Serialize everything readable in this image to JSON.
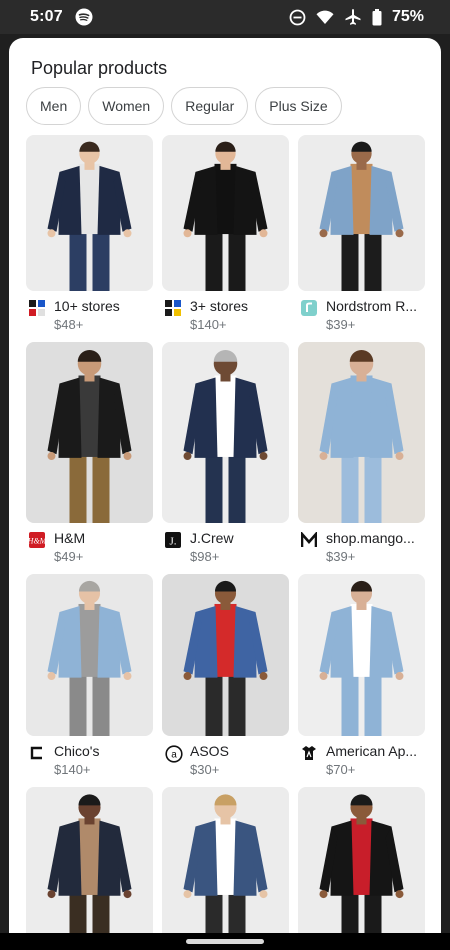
{
  "status_bar": {
    "time": "5:07",
    "battery": "75%",
    "icons": [
      "spotify-icon",
      "do-not-disturb-icon",
      "wifi-icon",
      "airplane-icon",
      "battery-icon"
    ]
  },
  "section": {
    "title": "Popular products",
    "chips": [
      {
        "label": "Men"
      },
      {
        "label": "Women"
      },
      {
        "label": "Regular"
      },
      {
        "label": "Plus Size"
      }
    ]
  },
  "products": [
    {
      "store": "10+ stores",
      "price": "$48+",
      "logo": "multi-store-icon",
      "jacket_color": "#1f2a44",
      "shirt_color": "#e6e6e6",
      "pants_color": "#2c3e63",
      "bg": "#ececec",
      "skin": "#e8c4a6",
      "hair": "#3a2a1f"
    },
    {
      "store": "3+ stores",
      "price": "$140+",
      "logo": "multi-store-icon",
      "jacket_color": "#141414",
      "shirt_color": "#111111",
      "pants_color": "#1a1a1a",
      "bg": "#ececec",
      "skin": "#e2b797",
      "hair": "#2a1f18"
    },
    {
      "store": "Nordstrom R...",
      "price": "$39+",
      "logo": "nordstrom-rack-icon",
      "jacket_color": "#7fa3c8",
      "shirt_color": "#c08c5c",
      "pants_color": "#1c1c1c",
      "bg": "#ececec",
      "skin": "#9a6a4a",
      "hair": "#1a1a1a"
    },
    {
      "store": "H&M",
      "price": "$49+",
      "logo": "hm-icon",
      "jacket_color": "#1a1a1a",
      "shirt_color": "#3a3a3a",
      "pants_color": "#8a6a3a",
      "bg": "#dedede",
      "skin": "#c89a78",
      "hair": "#2a1f18"
    },
    {
      "store": "J.Crew",
      "price": "$98+",
      "logo": "jcrew-icon",
      "jacket_color": "#22304f",
      "shirt_color": "#ffffff",
      "pants_color": "#243350",
      "bg": "#ececec",
      "skin": "#6e4a34",
      "hair": "#b5b5b5"
    },
    {
      "store": "shop.mango...",
      "price": "$39+",
      "logo": "mango-icon",
      "jacket_color": "#8fb3d6",
      "shirt_color": "#8fb3d6",
      "pants_color": "#9cbcdc",
      "bg": "#e4e0da",
      "skin": "#d8b096",
      "hair": "#5a3a24"
    },
    {
      "store": "Chico's",
      "price": "$140+",
      "logo": "chicos-icon",
      "jacket_color": "#8fb3d6",
      "shirt_color": "#9c9c9c",
      "pants_color": "#8a8a8a",
      "bg": "#e8e8e8",
      "skin": "#e6c2a6",
      "hair": "#a8a6a2"
    },
    {
      "store": "ASOS",
      "price": "$30+",
      "logo": "asos-icon",
      "jacket_color": "#3f64a3",
      "shirt_color": "#d42a2a",
      "pants_color": "#2a2a2a",
      "bg": "#dcdcdc",
      "skin": "#8a5a3a",
      "hair": "#1a1a1a"
    },
    {
      "store": "American Ap...",
      "price": "$70+",
      "logo": "american-eagle-icon",
      "jacket_color": "#8fb3d6",
      "shirt_color": "#ffffff",
      "pants_color": "#8fb3d6",
      "bg": "#eeeeee",
      "skin": "#d8b096",
      "hair": "#2a1f18"
    },
    {
      "store": "",
      "price": "",
      "logo": "",
      "jacket_color": "#222a3c",
      "shirt_color": "#b08a6a",
      "pants_color": "#3a2e22",
      "bg": "#ececec",
      "skin": "#6a4230",
      "hair": "#1a1a1a"
    },
    {
      "store": "",
      "price": "",
      "logo": "",
      "jacket_color": "#3a5580",
      "shirt_color": "#ffffff",
      "pants_color": "#2a2a2a",
      "bg": "#ececec",
      "skin": "#e6c4a6",
      "hair": "#c8a064"
    },
    {
      "store": "",
      "price": "",
      "logo": "",
      "jacket_color": "#151515",
      "shirt_color": "#c81e2a",
      "pants_color": "#1a1a1a",
      "bg": "#ececec",
      "skin": "#8a5a3a",
      "hair": "#1a1a1a"
    }
  ]
}
